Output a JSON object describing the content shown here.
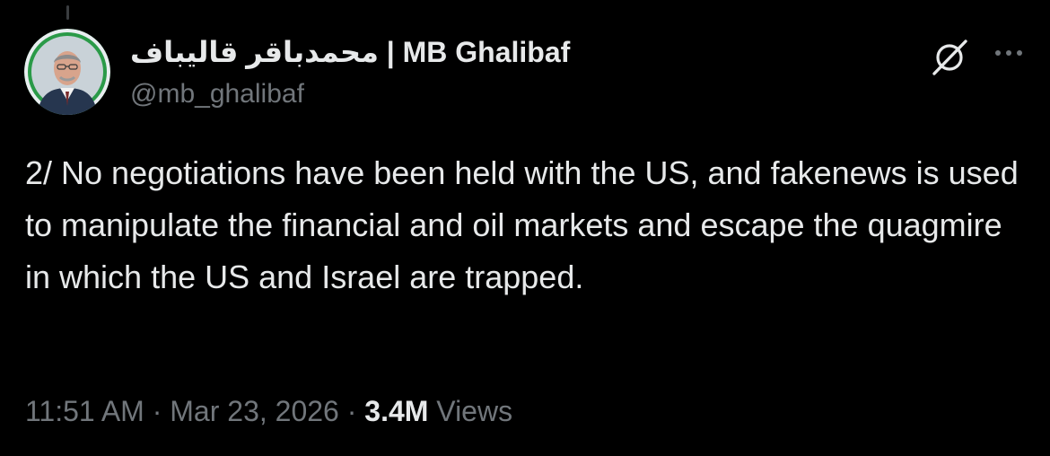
{
  "author": {
    "display_name": "محمدباقر قالیباف | MB Ghalibaf",
    "handle": "@mb_ghalibaf"
  },
  "tweet": {
    "text": "2/ No negotiations have been held with the US, and fakenews is used to manipulate the financial and oil markets and escape the quagmire in which the US and Israel are trapped."
  },
  "meta": {
    "time": "11:51 AM",
    "separator": " · ",
    "date": "Mar 23, 2026",
    "views_count": "3.4M",
    "views_label": " Views"
  },
  "icons": {
    "grok": "grok-icon",
    "more": "more-icon"
  },
  "colors": {
    "background": "#000000",
    "primary_text": "#e7e9ea",
    "secondary_text": "#71767b",
    "avatar_bg": "#1f8a3e"
  }
}
